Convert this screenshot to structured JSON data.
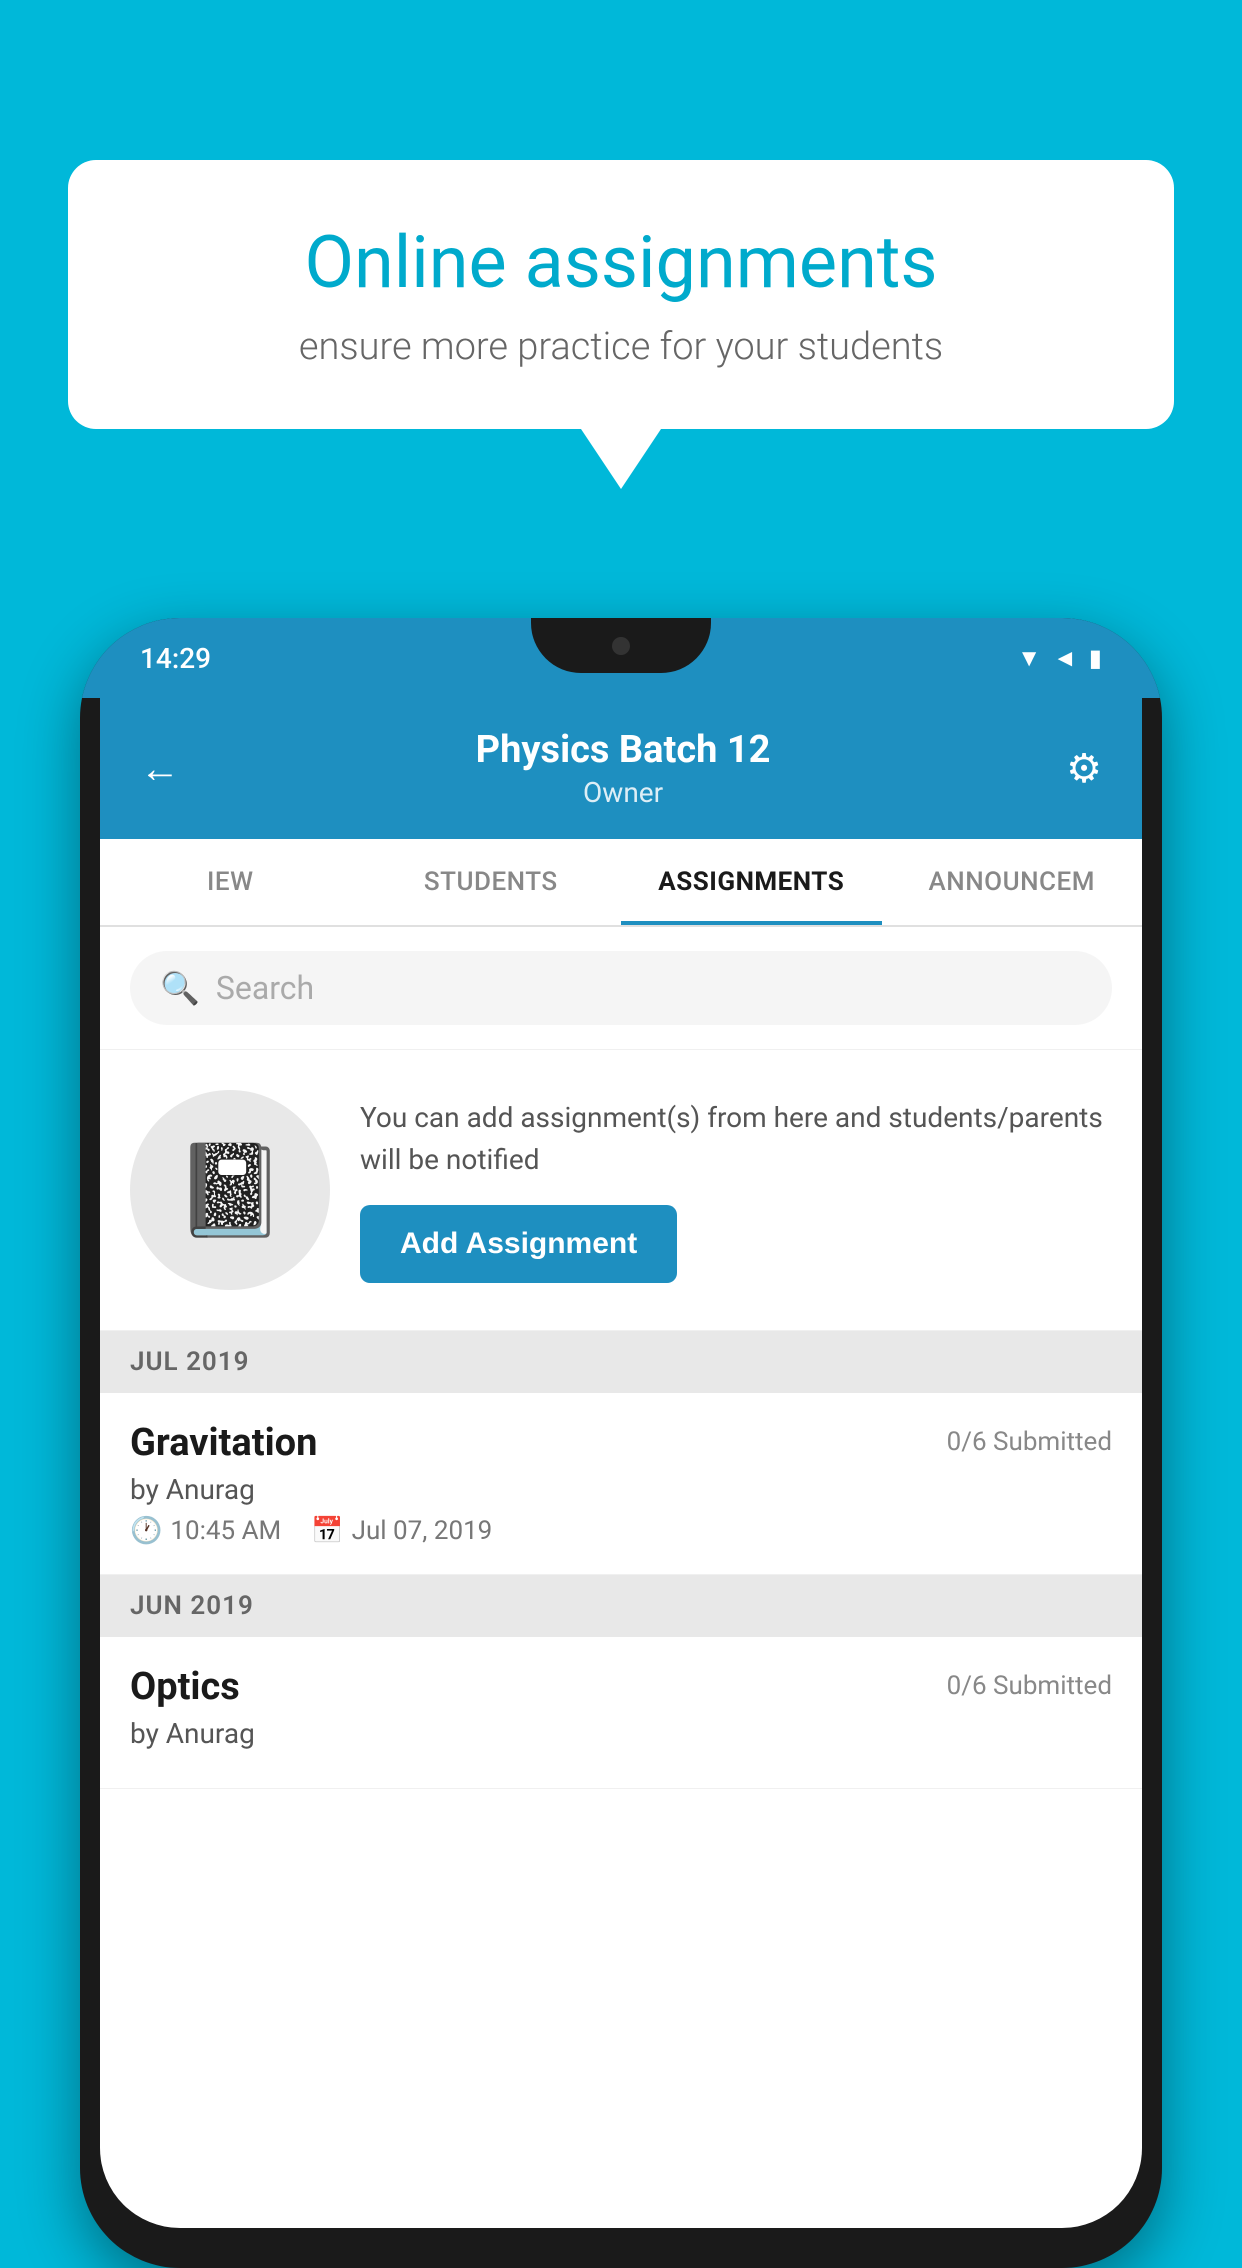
{
  "background": {
    "color": "#00b8d9"
  },
  "speech_bubble": {
    "title": "Online assignments",
    "subtitle": "ensure more practice for your students"
  },
  "status_bar": {
    "time": "14:29",
    "icons": [
      "wifi",
      "signal",
      "battery"
    ]
  },
  "header": {
    "title": "Physics Batch 12",
    "subtitle": "Owner",
    "back_label": "←",
    "settings_label": "⚙"
  },
  "tabs": [
    {
      "label": "IEW",
      "active": false
    },
    {
      "label": "STUDENTS",
      "active": false
    },
    {
      "label": "ASSIGNMENTS",
      "active": true
    },
    {
      "label": "ANNOUNCEM",
      "active": false
    }
  ],
  "search": {
    "placeholder": "Search"
  },
  "add_assignment_section": {
    "description": "You can add assignment(s) from here and students/parents will be notified",
    "button_label": "Add Assignment"
  },
  "sections": [
    {
      "header": "JUL 2019",
      "assignments": [
        {
          "name": "Gravitation",
          "submitted": "0/6 Submitted",
          "by": "by Anurag",
          "time": "10:45 AM",
          "date": "Jul 07, 2019"
        }
      ]
    },
    {
      "header": "JUN 2019",
      "assignments": [
        {
          "name": "Optics",
          "submitted": "0/6 Submitted",
          "by": "by Anurag",
          "time": "",
          "date": ""
        }
      ]
    }
  ]
}
